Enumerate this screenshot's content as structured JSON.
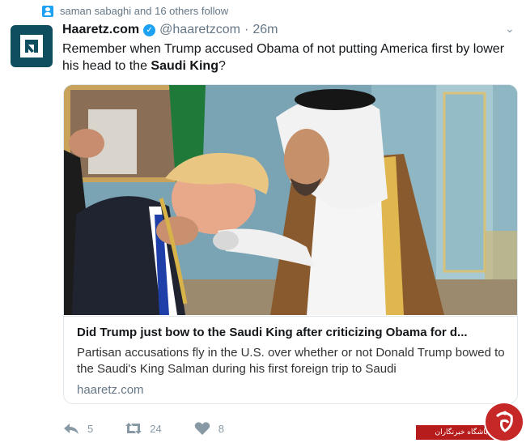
{
  "social_context": {
    "text": "saman sabaghi and 16 others follow",
    "icon": "person-icon"
  },
  "tweet": {
    "author_name": "Haaretz.com",
    "verified": true,
    "handle": "@haaretzcom",
    "separator": "·",
    "timestamp": "26m",
    "text_before": "Remember when Trump accused Obama of not putting America first by lower his head to the ",
    "text_bold": "Saudi King",
    "text_after": "?"
  },
  "card": {
    "title": "Did Trump just bow to the Saudi King after criticizing Obama for d...",
    "description": "Partisan accusations fly in the U.S. over whether or not Donald Trump bowed to the Saudi's King Salman during his first foreign trip to Saudi",
    "domain": "haaretz.com"
  },
  "actions": {
    "reply_count": "5",
    "retweet_count": "24",
    "like_count": "8"
  },
  "watermark": {
    "text": "باشگاه خبرنگاران"
  },
  "colors": {
    "accent": "#1da1f2",
    "muted": "#657786",
    "border": "#e1e8ed",
    "watermark_red": "#c62828"
  }
}
